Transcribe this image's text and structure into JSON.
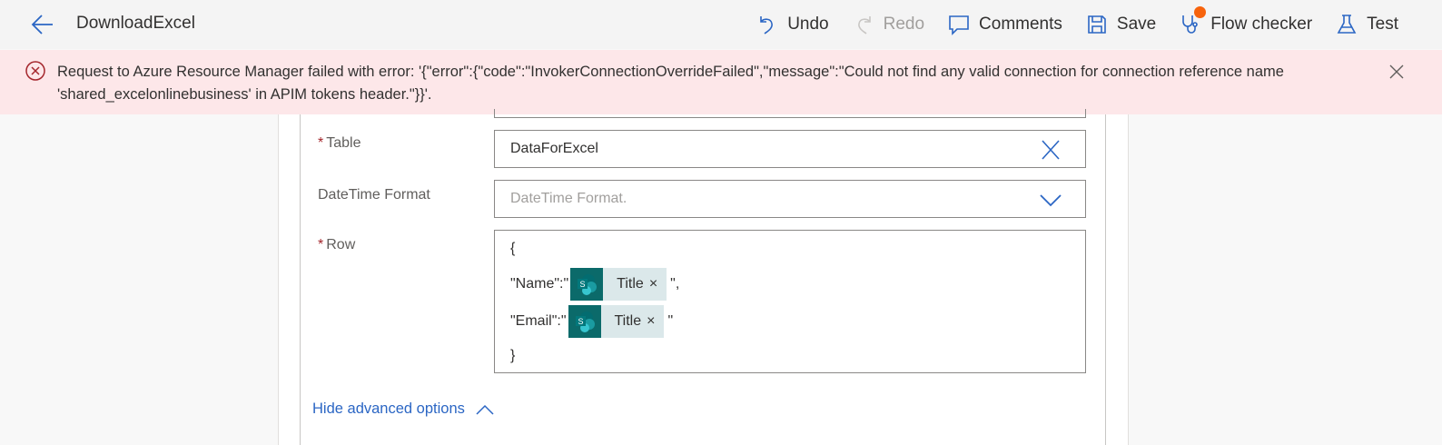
{
  "header": {
    "title": "DownloadExcel",
    "actions": [
      {
        "label": "Undo",
        "icon": "undo-icon"
      },
      {
        "label": "Redo",
        "icon": "redo-icon"
      },
      {
        "label": "Comments",
        "icon": "comment-icon"
      },
      {
        "label": "Save",
        "icon": "save-icon"
      },
      {
        "label": "Flow checker",
        "icon": "stethoscope-icon"
      },
      {
        "label": "Test",
        "icon": "flask-icon"
      }
    ]
  },
  "error": {
    "message": "Request to Azure Resource Manager failed with error: '{\"error\":{\"code\":\"InvokerConnectionOverrideFailed\",\"message\":\"Could not find any valid connection for connection reference name 'shared_excelonlinebusiness' in APIM tokens header.\"}}'."
  },
  "form": {
    "table": {
      "label": "Table",
      "required": "*",
      "value": "DataForExcel"
    },
    "datetime": {
      "label": "DateTime Format",
      "placeholder": "DateTime Format."
    },
    "row": {
      "label": "Row",
      "required": "*",
      "open": "{",
      "close": "}",
      "name_prefix": "\"Name\":\"",
      "name_suffix": "\",",
      "email_prefix": "\"Email\":\"",
      "email_suffix": "\"",
      "token_label": "Title",
      "token_badge": "S",
      "token_remove": "×"
    }
  },
  "advanced": {
    "label": "Hide advanced options"
  },
  "colors": {
    "accent": "#2b66c4",
    "error_bg": "#fde7e9",
    "token": "#0b6a6a"
  }
}
